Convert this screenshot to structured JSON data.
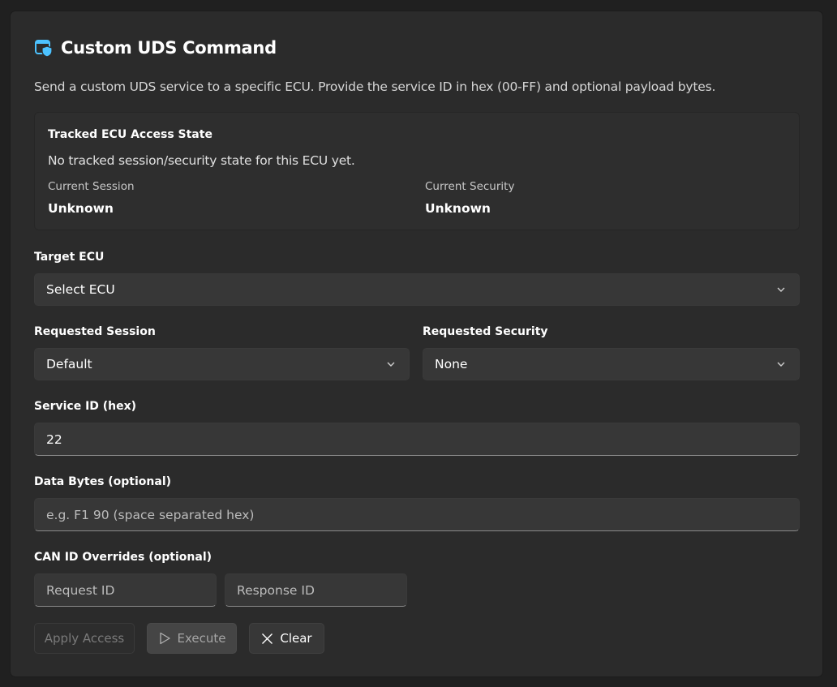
{
  "header": {
    "icon": "shield-window-icon",
    "title": "Custom UDS Command",
    "description": "Send a custom UDS service to a specific ECU. Provide the service ID in hex (00-FF) and optional payload bytes."
  },
  "tracked_state": {
    "title": "Tracked ECU Access State",
    "message": "No tracked session/security state for this ECU yet.",
    "current_session_label": "Current Session",
    "current_session_value": "Unknown",
    "current_security_label": "Current Security",
    "current_security_value": "Unknown"
  },
  "target_ecu": {
    "label": "Target ECU",
    "value": "Select ECU"
  },
  "requested_session": {
    "label": "Requested Session",
    "value": "Default"
  },
  "requested_security": {
    "label": "Requested Security",
    "value": "None"
  },
  "service_id": {
    "label": "Service ID (hex)",
    "value": "22"
  },
  "data_bytes": {
    "label": "Data Bytes (optional)",
    "value": "",
    "placeholder": "e.g. F1 90 (space separated hex)"
  },
  "can_overrides": {
    "label": "CAN ID Overrides (optional)",
    "request_placeholder": "Request ID",
    "response_placeholder": "Response ID"
  },
  "actions": {
    "apply_label": "Apply Access",
    "execute_label": "Execute",
    "clear_label": "Clear"
  },
  "colors": {
    "accent": "#4cc2ff",
    "background": "#202020",
    "card": "#2b2b2b"
  }
}
